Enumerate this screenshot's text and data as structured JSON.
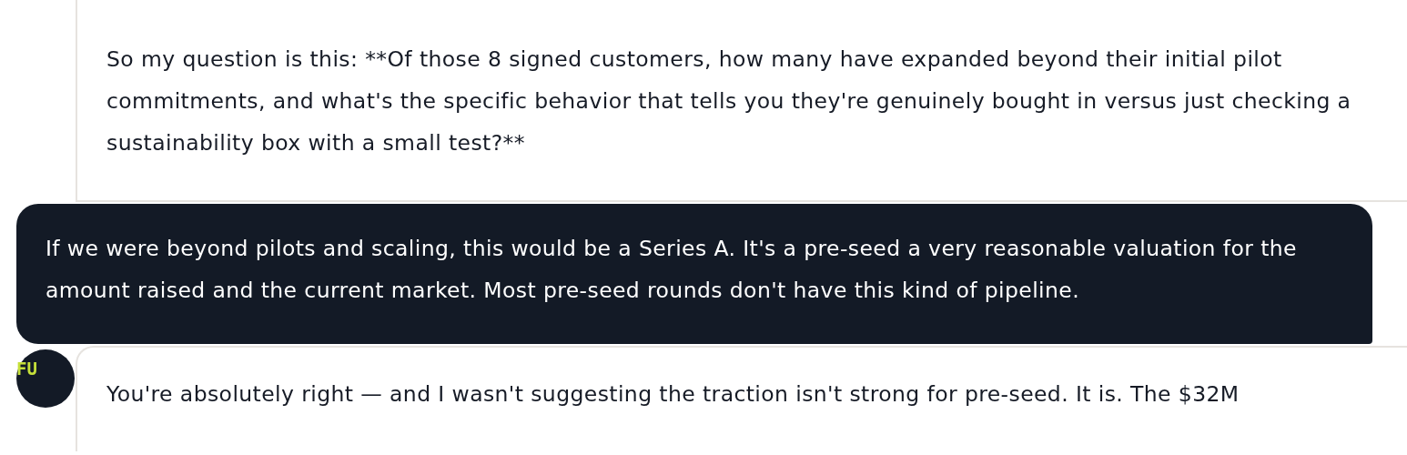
{
  "messages": [
    {
      "kind": "assistant",
      "text": "So my question is this: **Of those 8 signed customers, how many have expanded beyond their initial pilot commitments, and what's the specific behavior that tells you they're genuinely bought in versus just checking a sustainability box with a small test?**"
    },
    {
      "kind": "user",
      "text": "If we were beyond pilots and scaling, this would be a Series A. It's a pre-seed a very reasonable valuation for the amount raised and the current market. Most pre-seed rounds don't have this kind of pipeline."
    },
    {
      "kind": "assistant",
      "avatar": "FU",
      "text": "You're absolutely right — and I wasn't suggesting the traction isn't strong for pre-seed. It is. The $32M"
    }
  ]
}
